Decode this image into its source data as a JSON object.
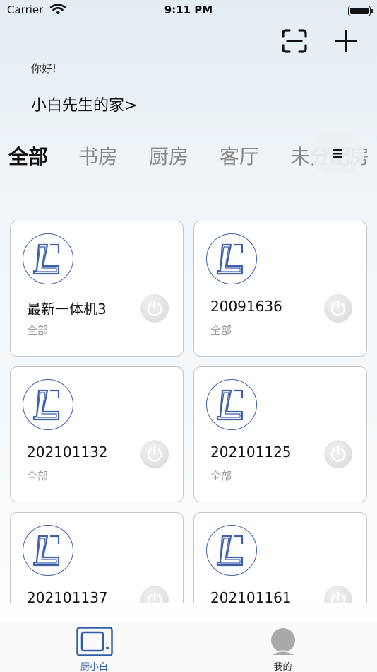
{
  "status_bar": {
    "carrier": "Carrier",
    "time": "9:11 PM"
  },
  "header": {
    "greeting": "你好!",
    "home_name": "小白先生的家>",
    "scan_icon": "scan-icon",
    "add_icon": "plus-icon"
  },
  "tabs": [
    {
      "label": "全部",
      "active": true
    },
    {
      "label": "书房",
      "active": false
    },
    {
      "label": "厨房",
      "active": false
    },
    {
      "label": "客厅",
      "active": false
    },
    {
      "label": "未分配房",
      "active": false
    }
  ],
  "menu_button": {
    "glyph": "≡",
    "icon": "hamburger-menu-icon"
  },
  "devices": [
    {
      "name": "最新一体机3",
      "room": "全部"
    },
    {
      "name": "20091636",
      "room": "全部"
    },
    {
      "name": "202101132",
      "room": "全部"
    },
    {
      "name": "202101125",
      "room": "全部"
    },
    {
      "name": "202101137",
      "room": ""
    },
    {
      "name": "202101161",
      "room": ""
    }
  ],
  "tabbar": [
    {
      "label": "厨小白",
      "icon": "monitor-icon",
      "active": true
    },
    {
      "label": "我的",
      "icon": "user-avatar-icon",
      "active": false
    }
  ],
  "colors": {
    "accent": "#2f5fa7",
    "logo_blue": "#3f5fa8",
    "inactive_tab": "#888888"
  }
}
